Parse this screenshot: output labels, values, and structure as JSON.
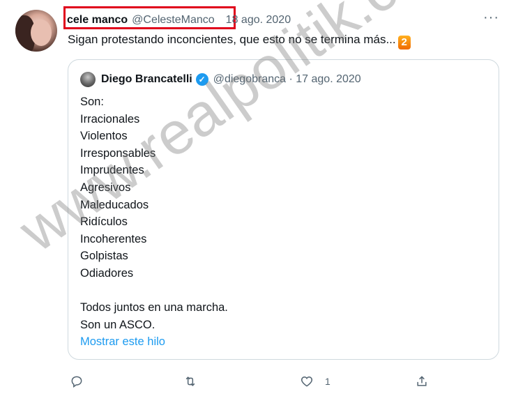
{
  "tweet": {
    "author_name": "cele manco",
    "author_handle": "@CelesteManco",
    "date": "18 ago. 2020",
    "more_label": "···",
    "text": "Sigan protestando inconcientes, que esto no se termina más...",
    "emoji": "2"
  },
  "quoted_tweet": {
    "author_name": "Diego Brancatelli",
    "author_handle": "@diegobranca",
    "separator": "·",
    "date": "17 ago. 2020",
    "lines": [
      "Son:",
      "Irracionales",
      "Violentos",
      "Irresponsables",
      "Imprudentes",
      "Agresivos",
      "Maleducados",
      "Ridículos",
      "Incoherentes",
      "Golpistas",
      "Odiadores",
      "",
      "Todos juntos en una marcha.",
      "Son un ASCO."
    ],
    "show_thread": "Mostrar este hilo"
  },
  "actions": {
    "reply_icon": "reply-icon",
    "retweet_icon": "retweet-icon",
    "like_icon": "heart-icon",
    "like_count": "1",
    "share_icon": "share-icon"
  },
  "watermark": "www.realpolitik.com.ar",
  "colors": {
    "highlight": "#e0001b",
    "link": "#1d9bf0",
    "secondary_text": "#536471"
  }
}
